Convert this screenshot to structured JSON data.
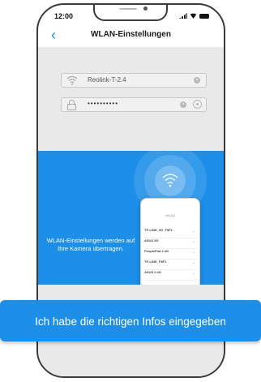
{
  "status": {
    "time": "12:00"
  },
  "nav": {
    "back": "‹",
    "title": "WLAN-Einstellungen"
  },
  "form": {
    "ssid_value": "Reolink-T-2.4",
    "password_value": "••••••••••"
  },
  "info": {
    "text": "WLAN-Einstellungen werden auf Ihre Kamera übertragen."
  },
  "mini_screen": {
    "header": "WLAN",
    "networks": [
      "TP-LINK_5G_F8F1",
      "ASUS 5G",
      "PeopleFlat 2.4G",
      "TP-LINK_F8F1",
      "ASUS 2.4G"
    ]
  },
  "cta": {
    "label": "Ich habe die richtigen Infos eingegeben"
  },
  "colors": {
    "accent": "#1d8fe8",
    "back": "#1f8fe6"
  }
}
